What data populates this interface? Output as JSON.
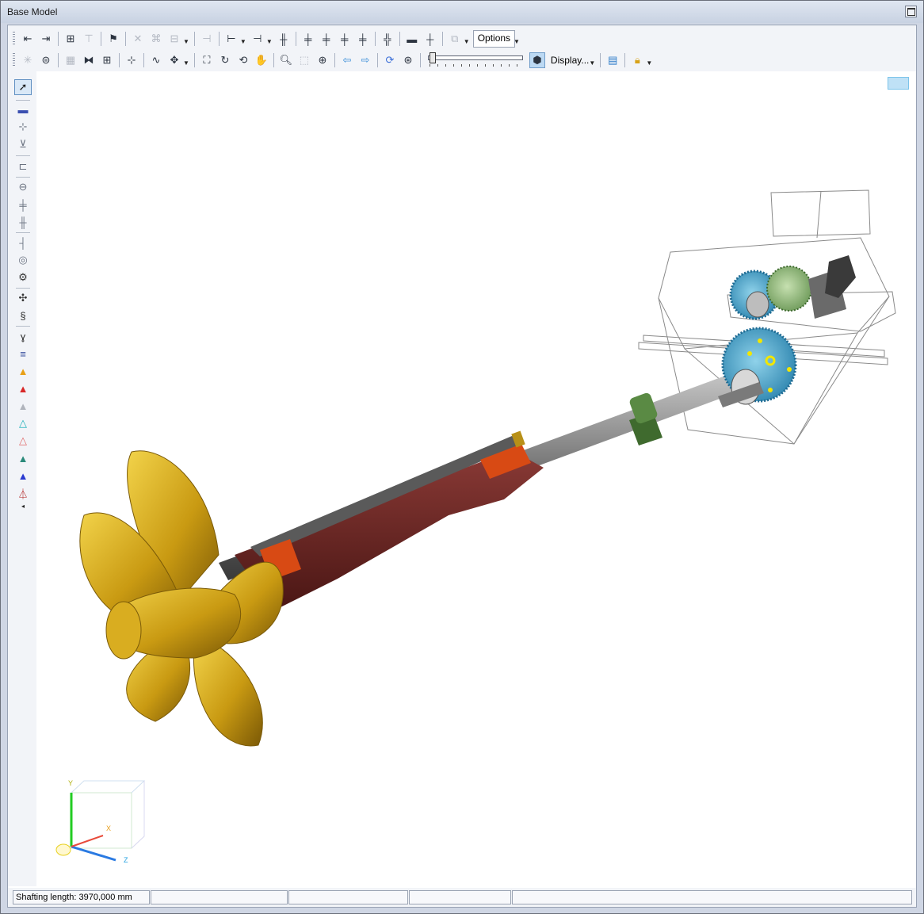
{
  "window": {
    "title": "Base Model"
  },
  "toolbar": {
    "options_label": "Options",
    "display_label": "Display..."
  },
  "viewport": {
    "axes": {
      "x": "X",
      "y": "Y",
      "z": "Z"
    }
  },
  "status": {
    "shafting_length": "Shafting length: 3970,000 mm",
    "pane2": "",
    "pane3": "",
    "pane4": "",
    "pane5": ""
  }
}
